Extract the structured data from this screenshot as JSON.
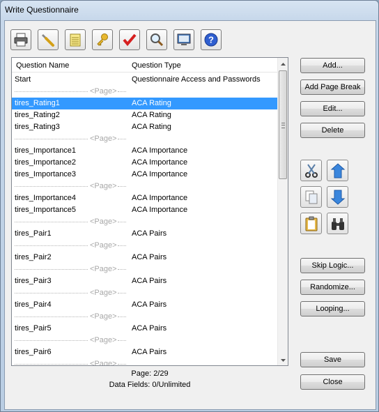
{
  "window": {
    "title": "Write Questionnaire"
  },
  "toolbar": {
    "buttons": [
      {
        "name": "print-button",
        "icon": "printer-icon"
      },
      {
        "name": "settings-button",
        "icon": "wrench-icon"
      },
      {
        "name": "notes-button",
        "icon": "notepad-icon"
      },
      {
        "name": "passwords-button",
        "icon": "key-icon"
      },
      {
        "name": "check-button",
        "icon": "checkmark-icon"
      },
      {
        "name": "search-button",
        "icon": "magnifier-icon"
      },
      {
        "name": "test-button",
        "icon": "test-screen-icon"
      },
      {
        "name": "help-button",
        "icon": "help-icon"
      }
    ]
  },
  "list": {
    "columns": [
      "Question Name",
      "Question Type"
    ],
    "page_label": "<Page>",
    "rows": [
      {
        "name": "Start",
        "type": "Questionnaire Access and Passwords",
        "kind": "item"
      },
      {
        "kind": "page"
      },
      {
        "name": "tires_Rating1",
        "type": "ACA Rating",
        "kind": "item",
        "selected": true
      },
      {
        "name": "tires_Rating2",
        "type": "ACA Rating",
        "kind": "item"
      },
      {
        "name": "tires_Rating3",
        "type": "ACA Rating",
        "kind": "item"
      },
      {
        "kind": "page"
      },
      {
        "name": "tires_Importance1",
        "type": "ACA Importance",
        "kind": "item"
      },
      {
        "name": "tires_Importance2",
        "type": "ACA Importance",
        "kind": "item"
      },
      {
        "name": "tires_Importance3",
        "type": "ACA Importance",
        "kind": "item"
      },
      {
        "kind": "page"
      },
      {
        "name": "tires_Importance4",
        "type": "ACA Importance",
        "kind": "item"
      },
      {
        "name": "tires_Importance5",
        "type": "ACA Importance",
        "kind": "item"
      },
      {
        "kind": "page"
      },
      {
        "name": "tires_Pair1",
        "type": "ACA Pairs",
        "kind": "item"
      },
      {
        "kind": "page"
      },
      {
        "name": "tires_Pair2",
        "type": "ACA Pairs",
        "kind": "item"
      },
      {
        "kind": "page"
      },
      {
        "name": "tires_Pair3",
        "type": "ACA Pairs",
        "kind": "item"
      },
      {
        "kind": "page"
      },
      {
        "name": "tires_Pair4",
        "type": "ACA Pairs",
        "kind": "item"
      },
      {
        "kind": "page"
      },
      {
        "name": "tires_Pair5",
        "type": "ACA Pairs",
        "kind": "item"
      },
      {
        "kind": "page"
      },
      {
        "name": "tires_Pair6",
        "type": "ACA Pairs",
        "kind": "item"
      },
      {
        "kind": "page"
      }
    ]
  },
  "status": {
    "page": "Page: 2/29",
    "fields": "Data Fields: 0/Unlimited"
  },
  "buttons": {
    "add": "Add...",
    "page_break": "Add Page Break",
    "edit": "Edit...",
    "delete": "Delete",
    "skip_logic": "Skip Logic...",
    "randomize": "Randomize...",
    "looping": "Looping...",
    "save": "Save",
    "close": "Close"
  },
  "colors": {
    "selection": "#3399ff",
    "accent_blue": "#2f7fd8"
  }
}
